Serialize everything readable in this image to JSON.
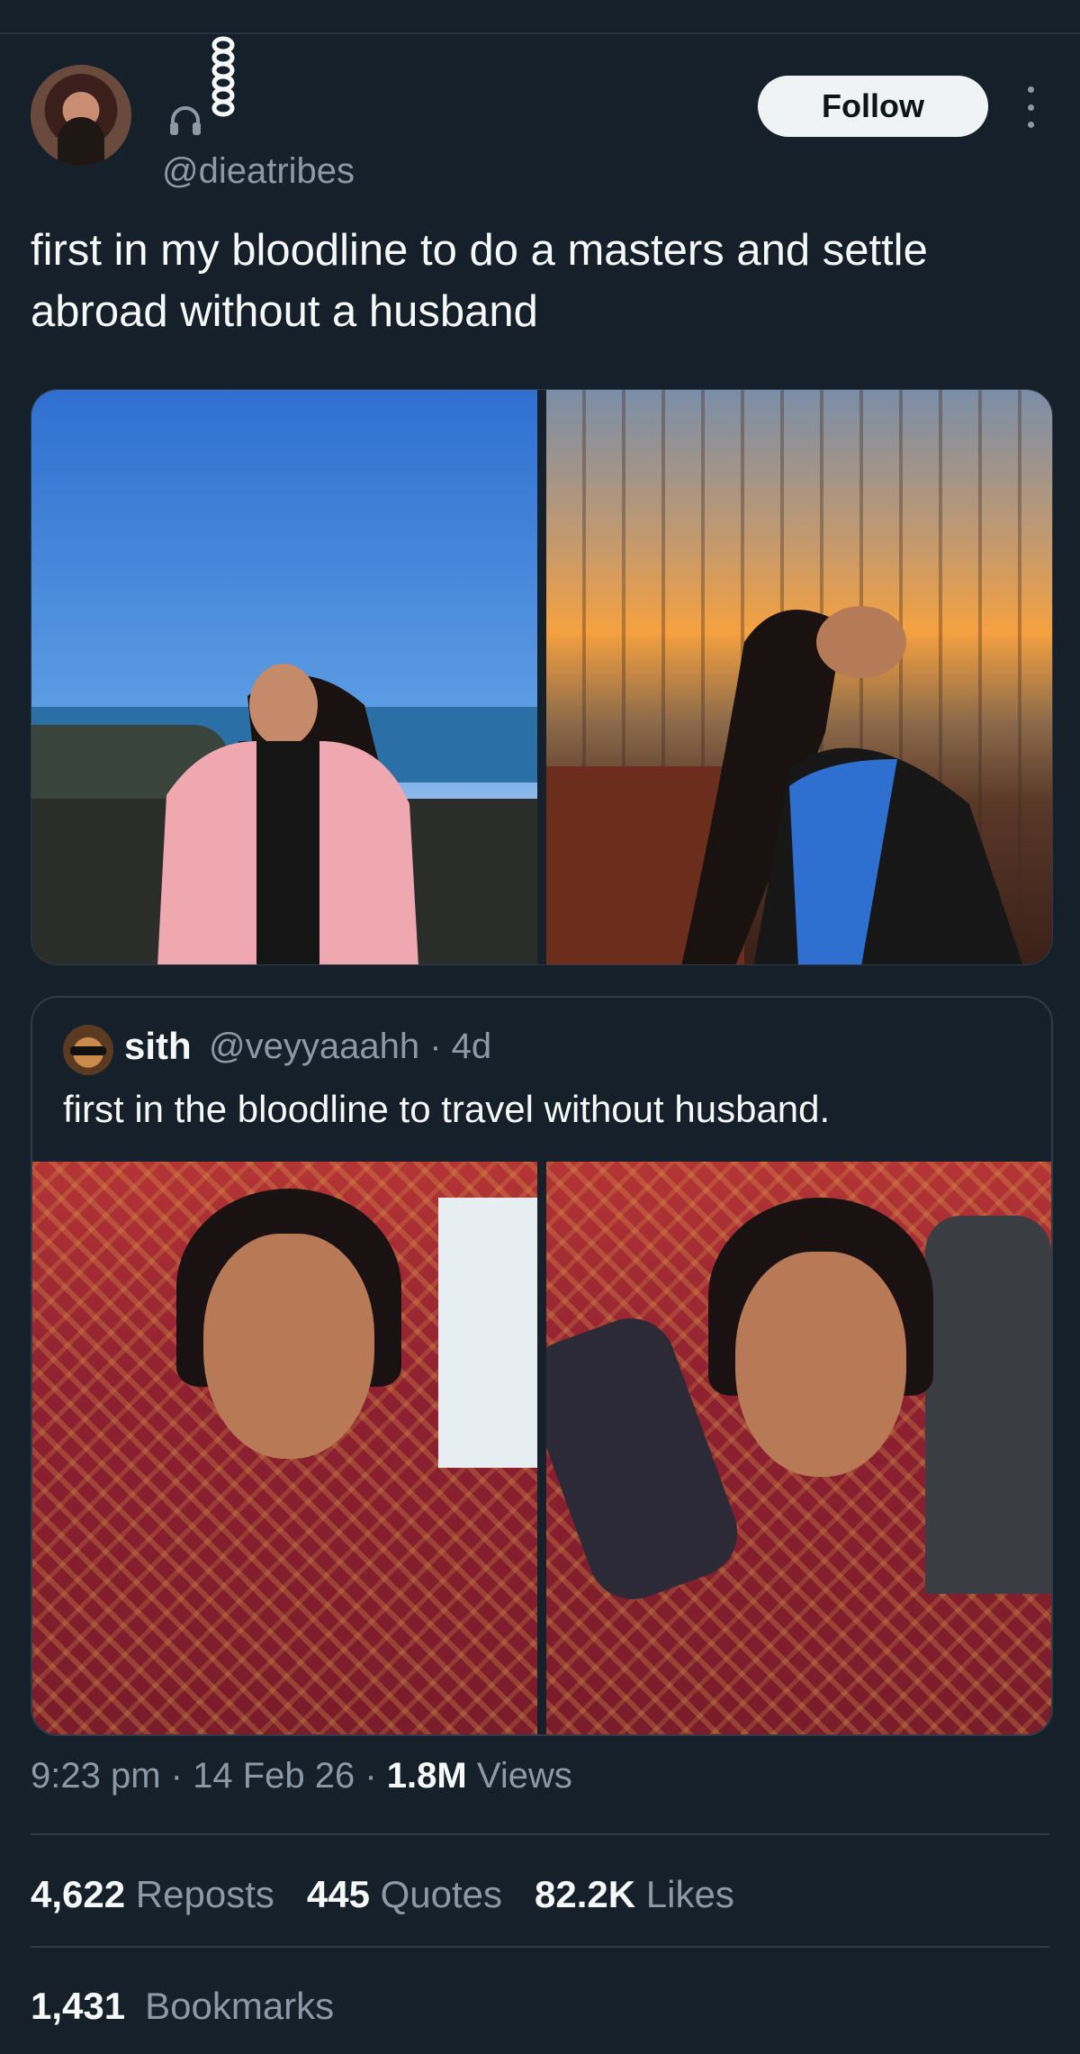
{
  "author": {
    "handle": "@dieatribes",
    "follow_label": "Follow"
  },
  "tweet": {
    "text": "first in my bloodline to do a masters and settle abroad without a husband"
  },
  "quoted": {
    "name": "sith",
    "handle": "@veyyaaahh",
    "age": "4d",
    "text": "first in the bloodline to travel without husband."
  },
  "meta": {
    "time": "9:23 pm",
    "date": "14 Feb 26",
    "views_count": "1.8M",
    "views_label": "Views"
  },
  "stats": {
    "reposts_count": "4,622",
    "reposts_label": "Reposts",
    "quotes_count": "445",
    "quotes_label": "Quotes",
    "likes_count": "82.2K",
    "likes_label": "Likes",
    "bookmarks_count": "1,431",
    "bookmarks_label": "Bookmarks"
  },
  "icons": {
    "more": "more-vertical-icon",
    "headphones": "headphones-icon"
  },
  "colors": {
    "background": "#15202b",
    "text": "#f7f9f9",
    "muted": "#8b98a5",
    "button": "#eff3f4",
    "border": "#2f3b46"
  }
}
